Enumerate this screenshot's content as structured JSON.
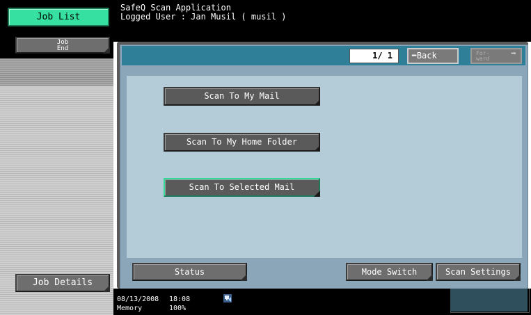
{
  "sidebar": {
    "job_list_label": "Job List",
    "job_end_label_line1": "Job",
    "job_end_label_line2": "End",
    "job_details_label": "Job Details"
  },
  "header": {
    "app_title": "SafeQ Scan Application",
    "logged_user": "Logged User : Jan Musil ( musil )"
  },
  "navigation": {
    "page_indicator": "1/ 1",
    "back_label": "Back",
    "forward_label_line1": "For-",
    "forward_label_line2": "ward"
  },
  "scan_options": {
    "my_mail": "Scan To My Mail",
    "home_folder": "Scan To My Home Folder",
    "selected_mail": "Scan To Selected Mail"
  },
  "bottom_bar": {
    "status_label": "Status",
    "mode_switch_label": "Mode Switch",
    "scan_settings_label": "Scan Settings"
  },
  "footer": {
    "date": "08/13/2008",
    "time": "18:08",
    "memory_label": "Memory",
    "memory_value": "100%"
  },
  "icons": {
    "back_arrow": "left-arrow-icon",
    "forward_arrow": "right-arrow-icon",
    "network": "network-icon"
  },
  "colors": {
    "active_green": "#35e0a0",
    "panel_blue": "#b4cbd8",
    "top_bar_teal": "#2f7f98"
  }
}
